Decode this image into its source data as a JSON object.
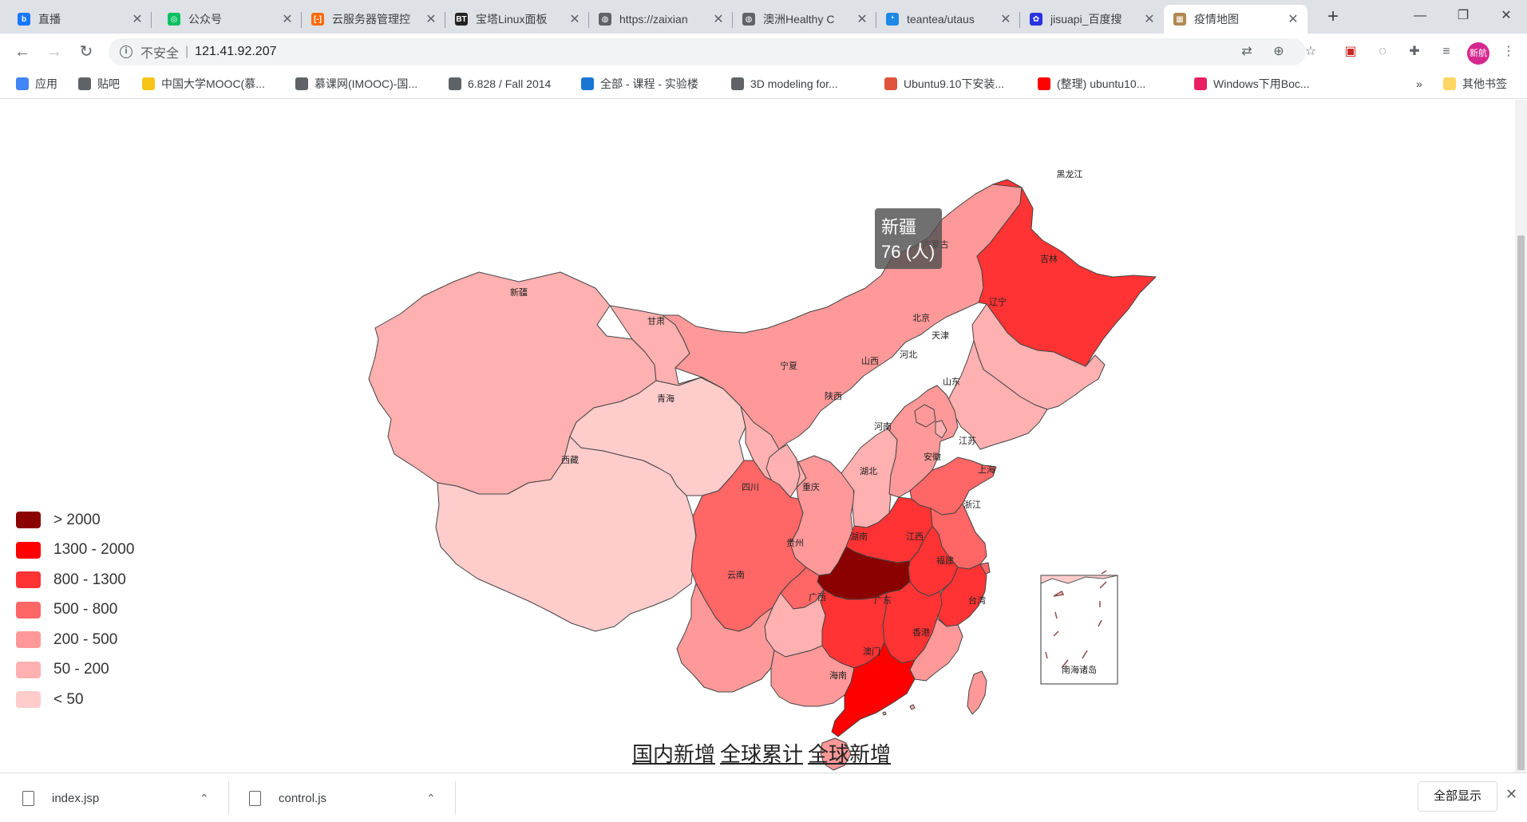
{
  "browser": {
    "tabs": [
      {
        "title": "直播",
        "icon": "bilibili-icon",
        "color": "#1677ff",
        "glyph": "b"
      },
      {
        "title": "公众号",
        "icon": "wechat-icon",
        "color": "#07c160",
        "glyph": "◎"
      },
      {
        "title": "云服务器管理控",
        "icon": "aliyun-icon",
        "color": "#ff6a00",
        "glyph": "[-]"
      },
      {
        "title": "宝塔Linux面板",
        "icon": "bt-icon",
        "color": "#222222",
        "glyph": "BT"
      },
      {
        "title": "https://zaixian",
        "icon": "globe-icon",
        "color": "#5f6368",
        "glyph": "◍"
      },
      {
        "title": "澳洲Healthy C",
        "icon": "globe-icon",
        "color": "#5f6368",
        "glyph": "◍"
      },
      {
        "title": "teantea/utaus",
        "icon": "drop-icon",
        "color": "#1e88e5",
        "glyph": "❛"
      },
      {
        "title": "jisuapi_百度搜",
        "icon": "baidu-icon",
        "color": "#2932e1",
        "glyph": "✿"
      },
      {
        "title": "疫情地图",
        "icon": "map-icon",
        "color": "#b08850",
        "glyph": "▦"
      }
    ],
    "active_tab": 8,
    "new_tab": "+",
    "url_security": "不安全",
    "url": "121.41.92.207",
    "profile": "新航",
    "bookmarks": [
      {
        "label": "应用",
        "icon": "apps-icon",
        "color": "#4285f4"
      },
      {
        "label": "贴吧",
        "icon": "globe-icon",
        "color": "#5f6368"
      },
      {
        "label": "中国大学MOOC(慕...",
        "icon": "mooc-icon",
        "color": "#f5c518"
      },
      {
        "label": "慕课网(IMOOC)-国...",
        "icon": "globe-icon",
        "color": "#5f6368"
      },
      {
        "label": "6.828 / Fall 2014",
        "icon": "globe-icon",
        "color": "#5f6368"
      },
      {
        "label": "全部 - 课程 - 实验楼",
        "icon": "hc-icon",
        "color": "#1976d2"
      },
      {
        "label": "3D modeling for...",
        "icon": "globe-icon",
        "color": "#5f6368"
      },
      {
        "label": "Ubuntu9.10下安装...",
        "icon": "jian-icon",
        "color": "#e0533c"
      },
      {
        "label": "(整理) ubuntu10...",
        "icon": "youtube-icon",
        "color": "#ff0000"
      },
      {
        "label": "Windows下用Boc...",
        "icon": "pinwheel-icon",
        "color": "#e91e63"
      }
    ],
    "bookmarks_more": "»",
    "other_bookmarks": "其他书签"
  },
  "map": {
    "tooltip": {
      "name": "新疆",
      "value": "76 (人)"
    },
    "legend": [
      {
        "label": "> 2000",
        "color": "#8b0000"
      },
      {
        "label": "1300 - 2000",
        "color": "#ff0000"
      },
      {
        "label": "800 - 1300",
        "color": "#ff3333"
      },
      {
        "label": "500 - 800",
        "color": "#ff6666"
      },
      {
        "label": "200 - 500",
        "color": "#ff9999"
      },
      {
        "label": "50 - 200",
        "color": "#ffb0b0"
      },
      {
        "label": "< 50",
        "color": "#ffcccc"
      }
    ],
    "provinces": [
      {
        "name": "新疆",
        "level": 5
      },
      {
        "name": "西藏",
        "level": 6
      },
      {
        "name": "青海",
        "level": 6
      },
      {
        "name": "甘肃",
        "level": 5
      },
      {
        "name": "内蒙古",
        "level": 4
      },
      {
        "name": "黑龙江",
        "level": 2
      },
      {
        "name": "吉林",
        "level": 5
      },
      {
        "name": "辽宁",
        "level": 5
      },
      {
        "name": "宁夏",
        "level": 5
      },
      {
        "name": "陕西",
        "level": 4
      },
      {
        "name": "山西",
        "level": 5
      },
      {
        "name": "河北",
        "level": 4
      },
      {
        "name": "北京",
        "level": 4
      },
      {
        "name": "天津",
        "level": 5
      },
      {
        "name": "山东",
        "level": 3
      },
      {
        "name": "河南",
        "level": 2
      },
      {
        "name": "江苏",
        "level": 3
      },
      {
        "name": "安徽",
        "level": 2
      },
      {
        "name": "上海",
        "level": 3
      },
      {
        "name": "湖北",
        "level": 0
      },
      {
        "name": "重庆",
        "level": 3
      },
      {
        "name": "四川",
        "level": 3
      },
      {
        "name": "浙江",
        "level": 2
      },
      {
        "name": "湖南",
        "level": 2
      },
      {
        "name": "江西",
        "level": 2
      },
      {
        "name": "福建",
        "level": 4
      },
      {
        "name": "贵州",
        "level": 5
      },
      {
        "name": "云南",
        "level": 4
      },
      {
        "name": "广西",
        "level": 4
      },
      {
        "name": "广东",
        "level": 1
      },
      {
        "name": "海南",
        "level": 4
      },
      {
        "name": "台湾",
        "level": 4
      },
      {
        "name": "香港",
        "level": 5
      },
      {
        "name": "澳门",
        "level": 5
      }
    ],
    "inset_label": "南海诸岛",
    "links": [
      "国内新增",
      "全球累计",
      "全球新增"
    ]
  },
  "downloads": {
    "items": [
      "index.jsp",
      "control.js"
    ],
    "show_all": "全部显示"
  }
}
